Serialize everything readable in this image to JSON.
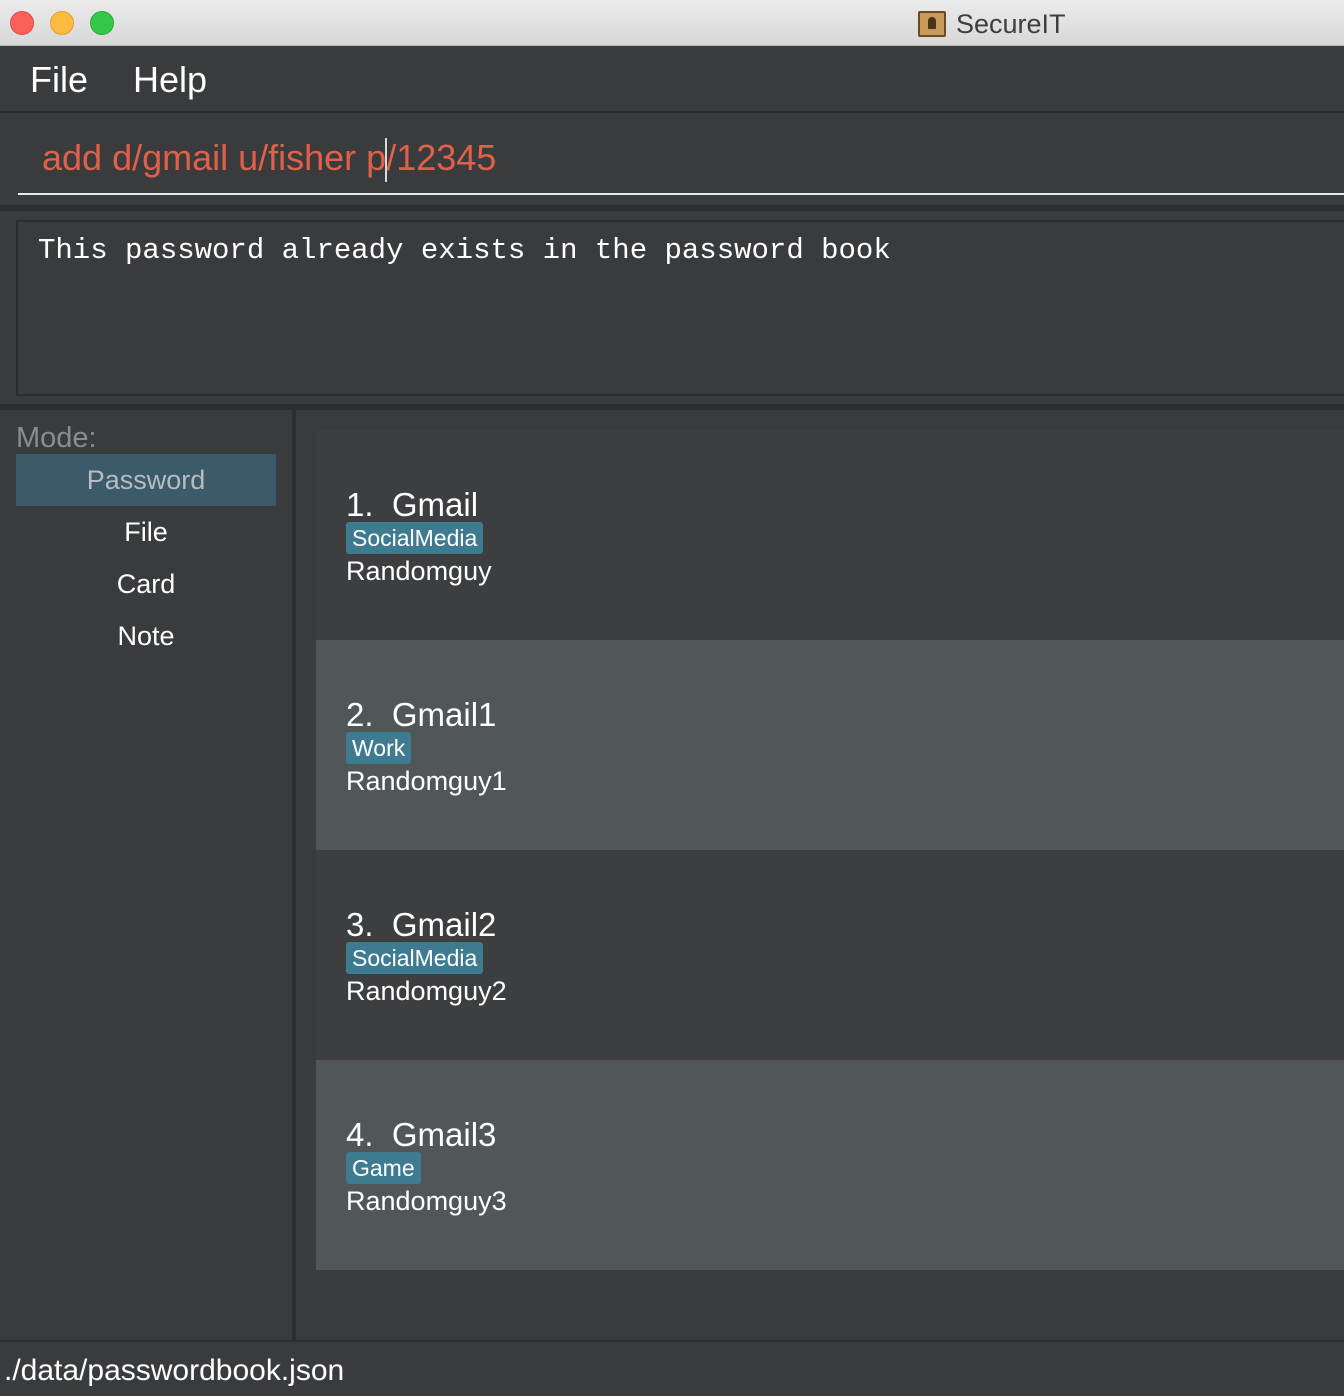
{
  "window": {
    "title": "SecureIT",
    "icon": "contacts-book-icon"
  },
  "menu": {
    "file": "File",
    "help": "Help"
  },
  "command": {
    "value": "add d/gmail u/fisher p/12345"
  },
  "result": {
    "message": "This password already exists in the password book"
  },
  "sidebar": {
    "label": "Mode:",
    "items": [
      {
        "label": "Password",
        "selected": true
      },
      {
        "label": "File",
        "selected": false
      },
      {
        "label": "Card",
        "selected": false
      },
      {
        "label": "Note",
        "selected": false
      }
    ]
  },
  "passwords": [
    {
      "index": "1.",
      "description": "Gmail",
      "tag": "SocialMedia",
      "username": "Randomguy"
    },
    {
      "index": "2.",
      "description": "Gmail1",
      "tag": "Work",
      "username": "Randomguy1"
    },
    {
      "index": "3.",
      "description": "Gmail2",
      "tag": "SocialMedia",
      "username": "Randomguy2"
    },
    {
      "index": "4.",
      "description": "Gmail3",
      "tag": "Game",
      "username": "Randomguy3"
    }
  ],
  "status": {
    "path": "./data/passwordbook.json"
  },
  "colors": {
    "command_text": "#e0604a",
    "tag_background": "#3e7b91",
    "selected_mode": "#3b5a6a",
    "card_alt": "#515658"
  }
}
